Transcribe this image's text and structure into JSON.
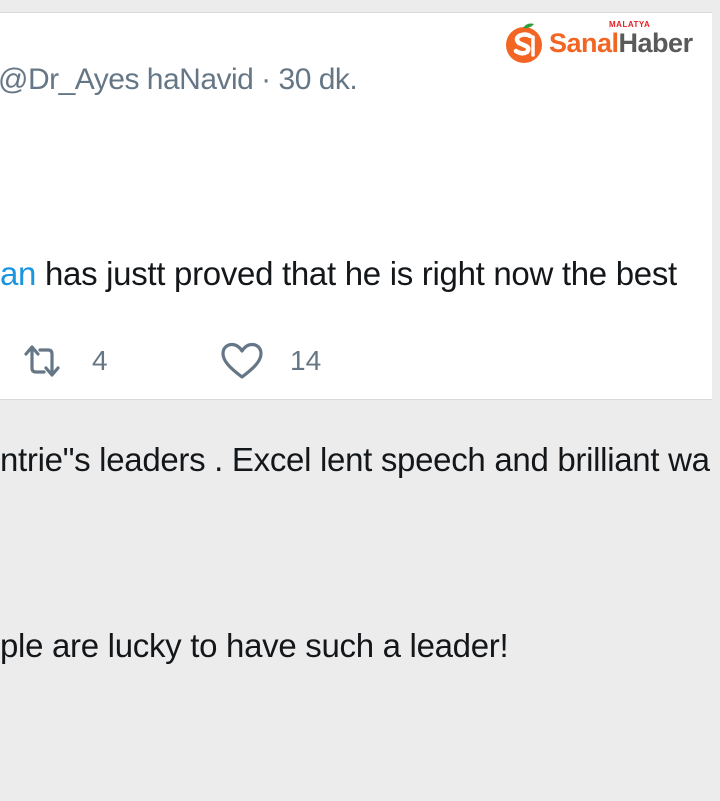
{
  "tweet": {
    "handle_line": "@Dr_Ayes haNavid · 30 dk.",
    "lines": [
      {
        "mention": "an",
        "text": " has justt proved that he is right now the best"
      },
      {
        "mention": "",
        "text": "ntrie\"s leaders . Excel lent speech and brilliant wa"
      },
      {
        "mention": "",
        "text": "ple are lucky to have such a leader!"
      }
    ]
  },
  "actions": {
    "retweet_count": "4",
    "like_count": "14"
  },
  "logo": {
    "sub": "MALATYA",
    "sanal": "Sanal",
    "haber": "Haber"
  },
  "colors": {
    "text": "#14171a",
    "muted": "#657786",
    "mention": "#1b95e0",
    "logo_orange": "#f26522",
    "logo_red": "#e31e24"
  },
  "icons": [
    "retweet-icon",
    "heart-icon",
    "sanalhaber-logo-icon"
  ]
}
